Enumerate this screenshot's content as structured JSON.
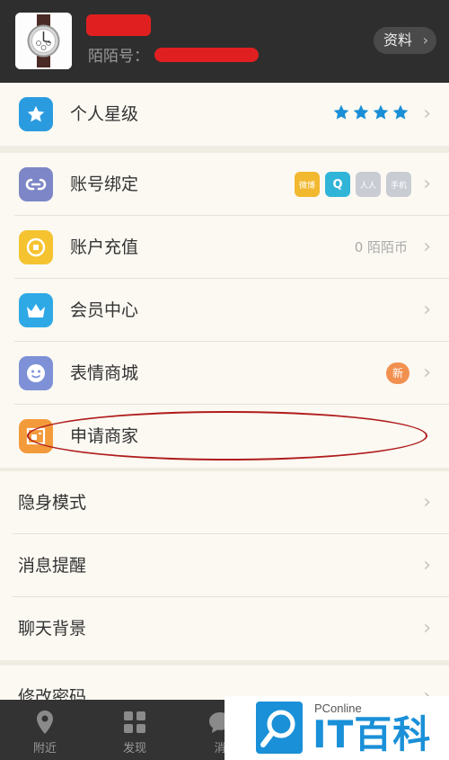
{
  "header": {
    "id_label": "陌陌号：",
    "profile_button": "资料"
  },
  "rows": {
    "star_level": "个人星级",
    "account_binding": "账号绑定",
    "recharge": "账户充值",
    "recharge_value": "0 陌陌币",
    "vip_center": "会员中心",
    "emoji_store": "表情商城",
    "emoji_badge": "新",
    "apply_merchant": "申请商家",
    "stealth_mode": "隐身模式",
    "notifications": "消息提醒",
    "chat_background": "聊天背景",
    "change_password": "修改密码"
  },
  "binding_badges": {
    "weibo": "微博",
    "qq": "Q",
    "renren": "人人",
    "phone": "手机"
  },
  "tabbar": {
    "nearby": "附近",
    "discover": "发现",
    "messages": "消"
  },
  "watermark": {
    "brand": "PConline",
    "name": "IT百科"
  },
  "colors": {
    "header_bg": "#2e2e2e",
    "list_bg": "#fbf9f2",
    "star_blue": "#1a8fd6",
    "annotation_red": "#b01c1c"
  }
}
